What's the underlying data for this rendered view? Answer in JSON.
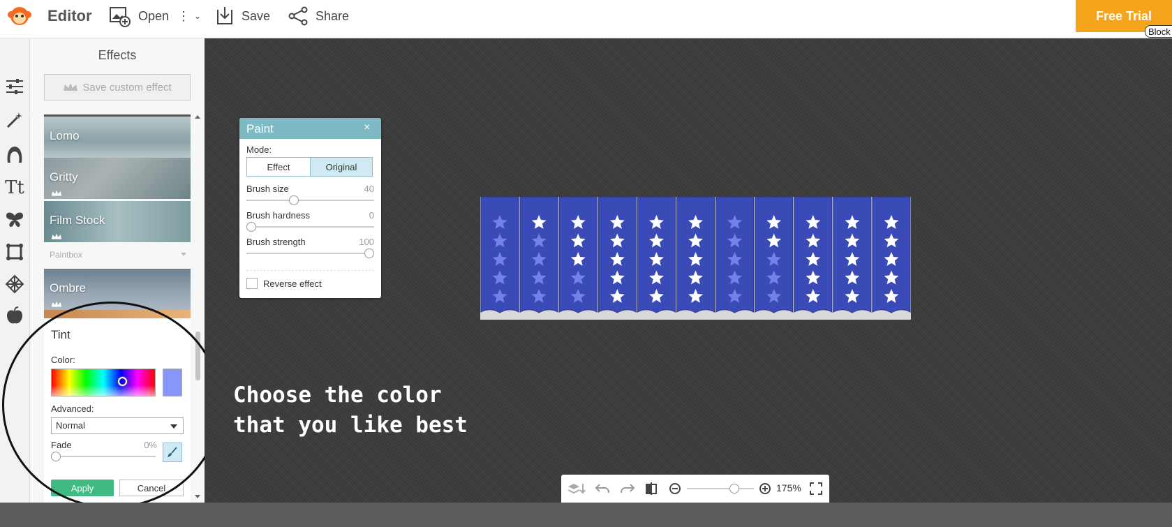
{
  "app": {
    "title": "Editor"
  },
  "toolbar": {
    "open_label": "Open",
    "save_label": "Save",
    "share_label": "Share"
  },
  "promo": {
    "free_trial_label": "Free Trial",
    "block_label": "Block"
  },
  "effects_panel": {
    "title": "Effects",
    "save_custom_label": "Save custom effect",
    "tiles": [
      {
        "label": "Lomo",
        "premium": false
      },
      {
        "label": "Gritty",
        "premium": true
      },
      {
        "label": "Film Stock",
        "premium": true
      },
      {
        "label": "Ombre",
        "premium": true
      }
    ],
    "section_label": "Paintbox"
  },
  "tint": {
    "title": "Tint",
    "color_label": "Color:",
    "selected_color": "#8896f7",
    "advanced_label": "Advanced:",
    "advanced_value": "Normal",
    "fade_label": "Fade",
    "fade_value": "0%",
    "apply_label": "Apply",
    "cancel_label": "Cancel"
  },
  "paint": {
    "title": "Paint",
    "close_label": "×",
    "mode_label": "Mode:",
    "mode_effect": "Effect",
    "mode_original": "Original",
    "brush_size_label": "Brush size",
    "brush_size_value": "40",
    "brush_hardness_label": "Brush hardness",
    "brush_hardness_value": "0",
    "brush_strength_label": "Brush strength",
    "brush_strength_value": "100",
    "reverse_label": "Reverse effect"
  },
  "canvas": {
    "caption": "Choose the color\nthat you like best",
    "zoom_value": "175%"
  },
  "colors": {
    "accent_orange": "#f7a41d",
    "paint_header": "#7dbac4",
    "apply_green": "#40b983",
    "banner_blue": "#3a4bb7"
  }
}
